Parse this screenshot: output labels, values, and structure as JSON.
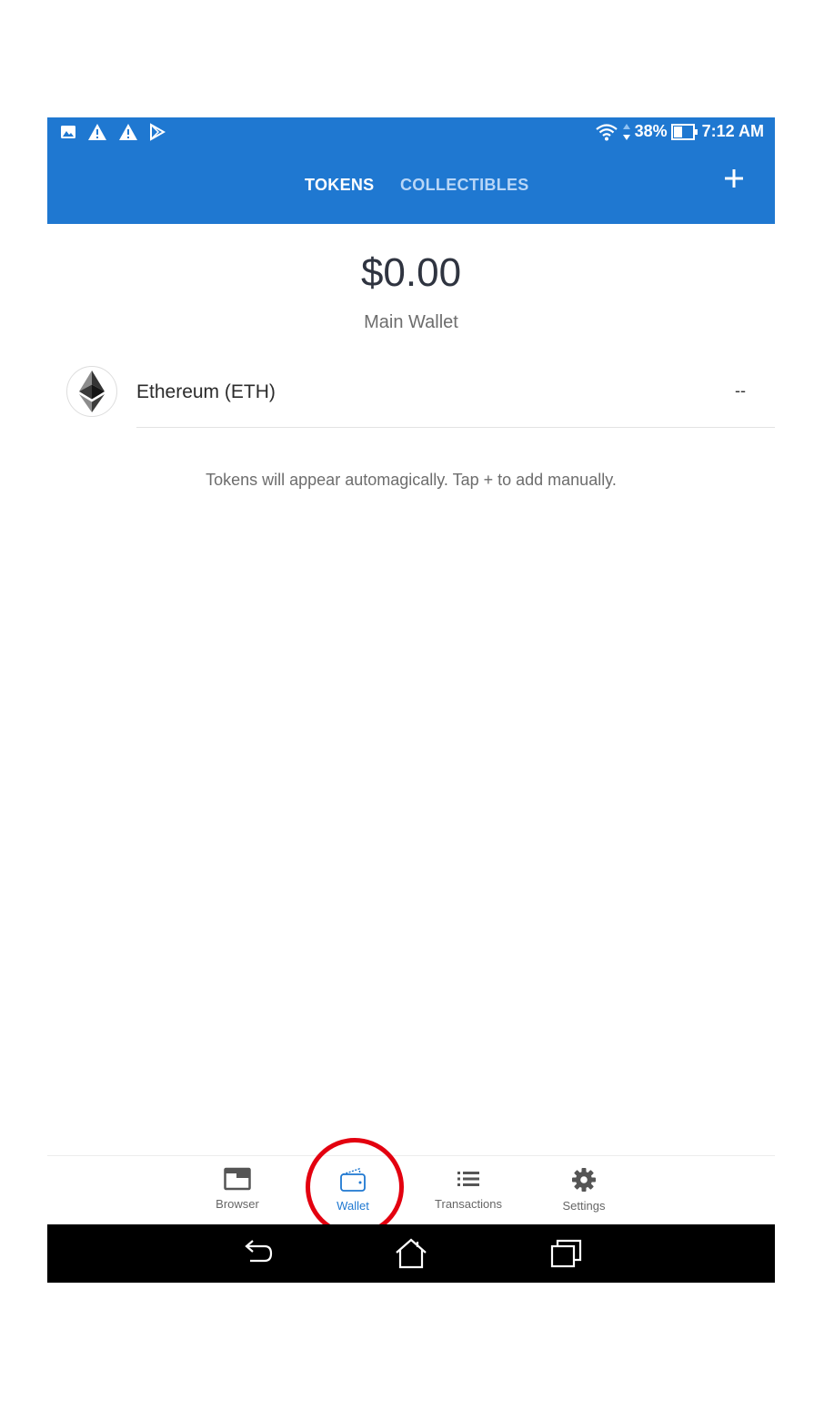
{
  "status_bar": {
    "left_icons": [
      "image-icon",
      "warning-icon",
      "warning-icon",
      "play-store-icon"
    ],
    "battery": "38%",
    "time": "7:12 AM"
  },
  "header": {
    "tabs": [
      {
        "label": "TOKENS",
        "active": true
      },
      {
        "label": "COLLECTIBLES",
        "active": false
      }
    ],
    "add_icon": "plus-icon"
  },
  "wallet": {
    "balance": "$0.00",
    "name": "Main Wallet"
  },
  "tokens": [
    {
      "name": "Ethereum (ETH)",
      "value": "--",
      "icon": "ethereum-logo-icon"
    }
  ],
  "hint": "Tokens will appear automagically. Tap + to add manually.",
  "bottom_nav": {
    "items": [
      {
        "label": "Browser",
        "icon": "browser-icon",
        "active": false
      },
      {
        "label": "Wallet",
        "icon": "wallet-icon",
        "active": true
      },
      {
        "label": "Transactions",
        "icon": "list-icon",
        "active": false
      },
      {
        "label": "Settings",
        "icon": "gear-icon",
        "active": false
      }
    ]
  },
  "system_nav": [
    "back-icon",
    "home-icon",
    "recents-icon"
  ],
  "colors": {
    "accent": "#1f78d1",
    "inactive_tab": "#b8d6f7",
    "highlight_ring": "#e3000f"
  }
}
